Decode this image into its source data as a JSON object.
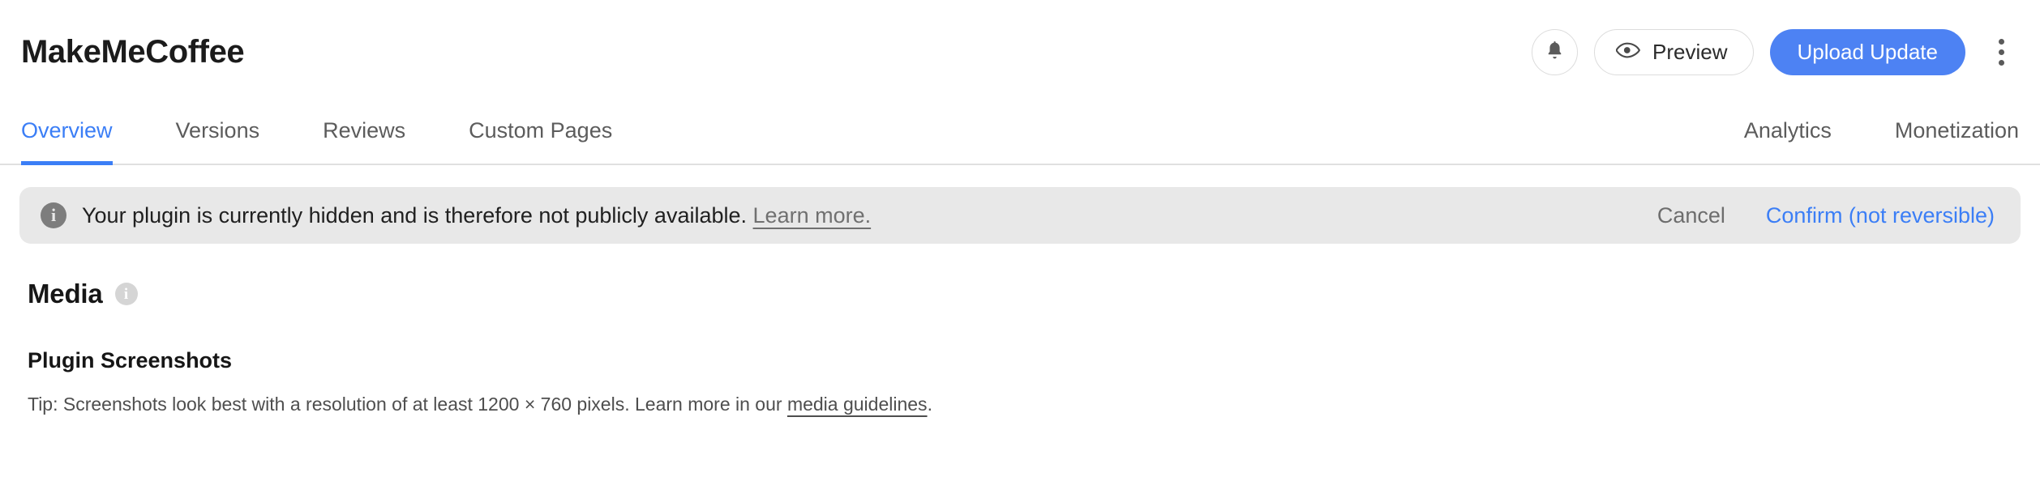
{
  "header": {
    "app_title": "MakeMeCoffee",
    "notifications_icon": "bell-icon",
    "preview_label": "Preview",
    "preview_icon": "eye-icon",
    "upload_label": "Upload Update",
    "more_icon": "kebab-menu-icon",
    "accent_color": "#4d82f3"
  },
  "tabs": {
    "left": [
      {
        "label": "Overview",
        "active": true
      },
      {
        "label": "Versions",
        "active": false
      },
      {
        "label": "Reviews",
        "active": false
      },
      {
        "label": "Custom Pages",
        "active": false
      }
    ],
    "right": [
      {
        "label": "Analytics",
        "active": false
      },
      {
        "label": "Monetization",
        "active": false
      }
    ],
    "active_color": "#3b7ef6",
    "inactive_color": "#5c5c5c"
  },
  "banner": {
    "icon": "info-icon",
    "icon_glyph": "i",
    "message": "Your plugin is currently hidden and is therefore not publicly available.",
    "link_label": "Learn more.",
    "cancel_label": "Cancel",
    "confirm_label": "Confirm (not reversible)",
    "background_color": "#e8e8e8",
    "confirm_color": "#3b7ef6"
  },
  "media": {
    "section_title": "Media",
    "info_icon": "info-icon",
    "info_glyph": "i",
    "screenshots": {
      "title": "Plugin Screenshots",
      "tip_prefix": "Tip: Screenshots look best with a resolution of at least 1200 × 760 pixels. Learn more in our ",
      "tip_link": "media guidelines",
      "tip_suffix": "."
    }
  }
}
